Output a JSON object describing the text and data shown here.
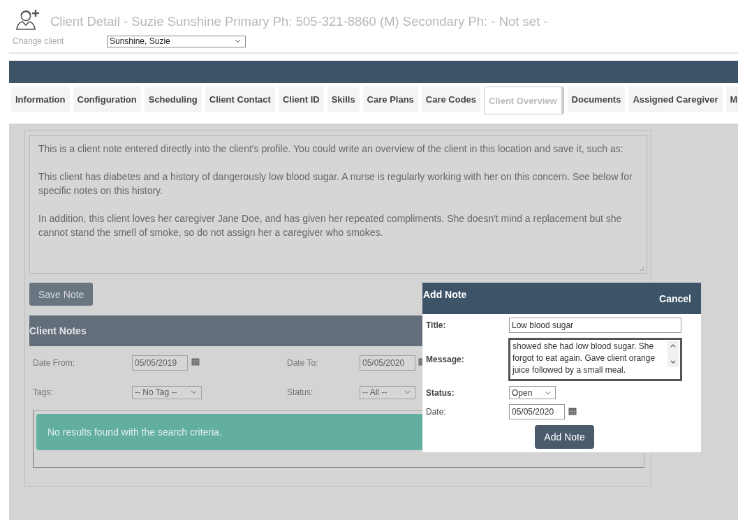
{
  "header": {
    "title": "Client Detail - Suzie Sunshine Primary Ph: 505-321-8860 (M) Secondary Ph: - Not set -",
    "change_client_label": "Change client",
    "client_select": "Sunshine, Suzie"
  },
  "tabs": [
    {
      "label": "Information",
      "selected": false
    },
    {
      "label": "Configuration",
      "selected": false
    },
    {
      "label": "Scheduling",
      "selected": false
    },
    {
      "label": "Client Contact",
      "selected": false
    },
    {
      "label": "Client ID",
      "selected": false
    },
    {
      "label": "Skills",
      "selected": false
    },
    {
      "label": "Care Plans",
      "selected": false
    },
    {
      "label": "Care Codes",
      "selected": false
    },
    {
      "label": "Client Overview",
      "selected": true
    },
    {
      "label": "Documents",
      "selected": false
    },
    {
      "label": "Assigned Caregiver",
      "selected": false
    },
    {
      "label": "M",
      "selected": false
    }
  ],
  "overview_note": "This is a client note entered directly into the client's profile. You could write an overview of the client in this location and save it, such as:\n\nThis client has diabetes and a history of dangerously low blood sugar. A nurse is regularly working with her on this concern. See below for specific notes on this history.\n\nIn addition, this client loves her caregiver Jane Doe, and has given her repeated compliments. She doesn't mind a replacement but she cannot stand the smell of smoke, so do not assign her a caregiver who smokes.",
  "save_button": "Save Note",
  "client_notes": {
    "title": "Client Notes",
    "filters": [
      {
        "label": "Date From:",
        "kind": "date",
        "value": "05/05/2019"
      },
      {
        "label": "Date To:",
        "kind": "date",
        "value": "05/05/2020"
      },
      {
        "label": "Tags:",
        "kind": "select",
        "value": "-- No Tag --"
      },
      {
        "label": "Status:",
        "kind": "select",
        "value": "-- All --"
      }
    ],
    "empty_message": "No results found with the search criteria."
  },
  "add_note_dialog": {
    "title": "Add Note",
    "cancel": "Cancel",
    "fields": [
      {
        "label": "Title:",
        "kind": "text",
        "value": "Low blood sugar"
      },
      {
        "label": "Message:",
        "kind": "textarea",
        "value": "showed she had low blood sugar. She forgot to eat again. Gave client orange juice followed by a small meal."
      },
      {
        "label": "Status:",
        "kind": "select",
        "value": "Open"
      },
      {
        "label": "Date:",
        "kind": "date",
        "value": "05/05/2020"
      }
    ],
    "submit": "Add Note"
  }
}
